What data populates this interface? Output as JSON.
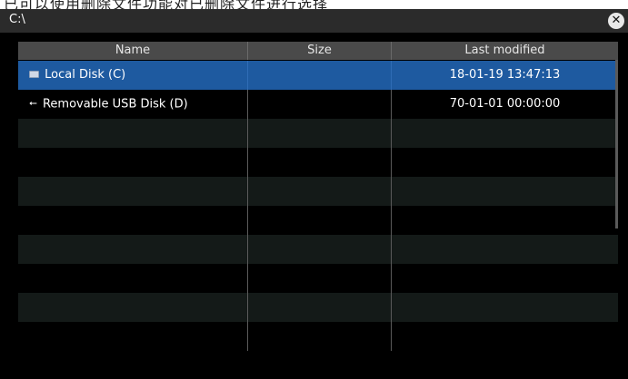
{
  "top_strip_text": "已可以使用删除文件功能对已删除文件进行选择",
  "window": {
    "title": "C:\\",
    "close_label": "✕"
  },
  "table": {
    "columns": [
      "Name",
      "Size",
      "Last modified"
    ],
    "rows": [
      {
        "icon": "disk-icon",
        "name": "Local Disk (C)",
        "size": "",
        "modified": "18-01-19 13:47:13",
        "selected": true
      },
      {
        "icon": "usb-icon",
        "name": "Removable USB Disk (D)",
        "size": "",
        "modified": "70-01-01 00:00:00",
        "selected": false
      }
    ],
    "empty_row_count": 8
  },
  "colors": {
    "selected_row": "#1e5aa0",
    "header_bg": "#4a4a4a",
    "titlebar_bg": "#2b2b2b"
  }
}
